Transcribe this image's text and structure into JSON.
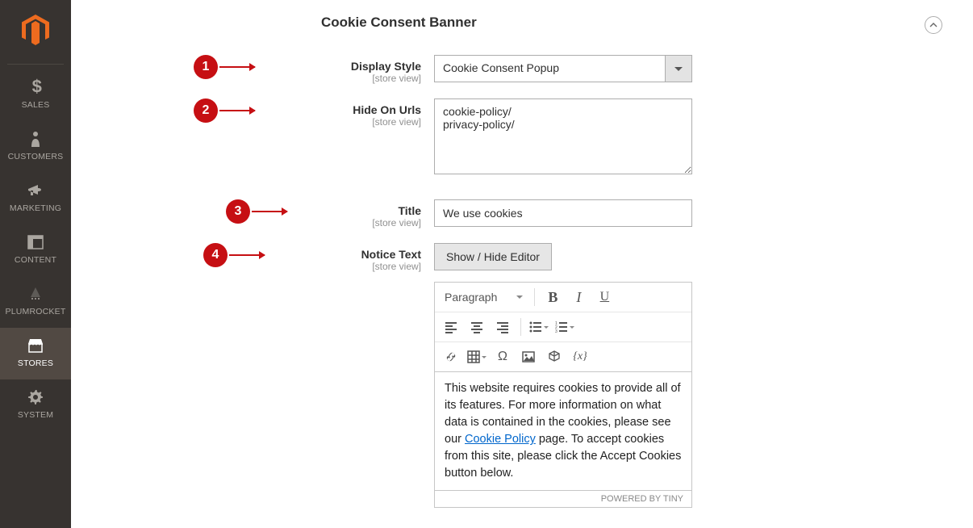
{
  "sidebar": {
    "items": [
      {
        "label": "SALES"
      },
      {
        "label": "CUSTOMERS"
      },
      {
        "label": "MARKETING"
      },
      {
        "label": "CONTENT"
      },
      {
        "label": "PLUMROCKET"
      },
      {
        "label": "STORES"
      },
      {
        "label": "SYSTEM"
      }
    ]
  },
  "page": {
    "title": "Cookie Consent Banner"
  },
  "annotations": {
    "one": "1",
    "two": "2",
    "three": "3",
    "four": "4"
  },
  "fields": {
    "display_style": {
      "label": "Display Style",
      "scope": "[store view]",
      "value": "Cookie Consent Popup"
    },
    "hide_on_urls": {
      "label": "Hide On Urls",
      "scope": "[store view]",
      "value": "cookie-policy/\nprivacy-policy/"
    },
    "title": {
      "label": "Title",
      "scope": "[store view]",
      "value": "We use cookies"
    },
    "notice_text": {
      "label": "Notice Text",
      "scope": "[store view]",
      "toggle": "Show / Hide Editor",
      "format": "Paragraph"
    }
  },
  "editor": {
    "paragraph_before_link": "This website requires cookies to provide all of its features. For more information on what data is contained in the cookies, please see our ",
    "link_text": "Cookie Policy",
    "paragraph_after_link": " page. To accept cookies from this site, please click the Accept Cookies button below.",
    "footer": "POWERED BY TINY"
  }
}
